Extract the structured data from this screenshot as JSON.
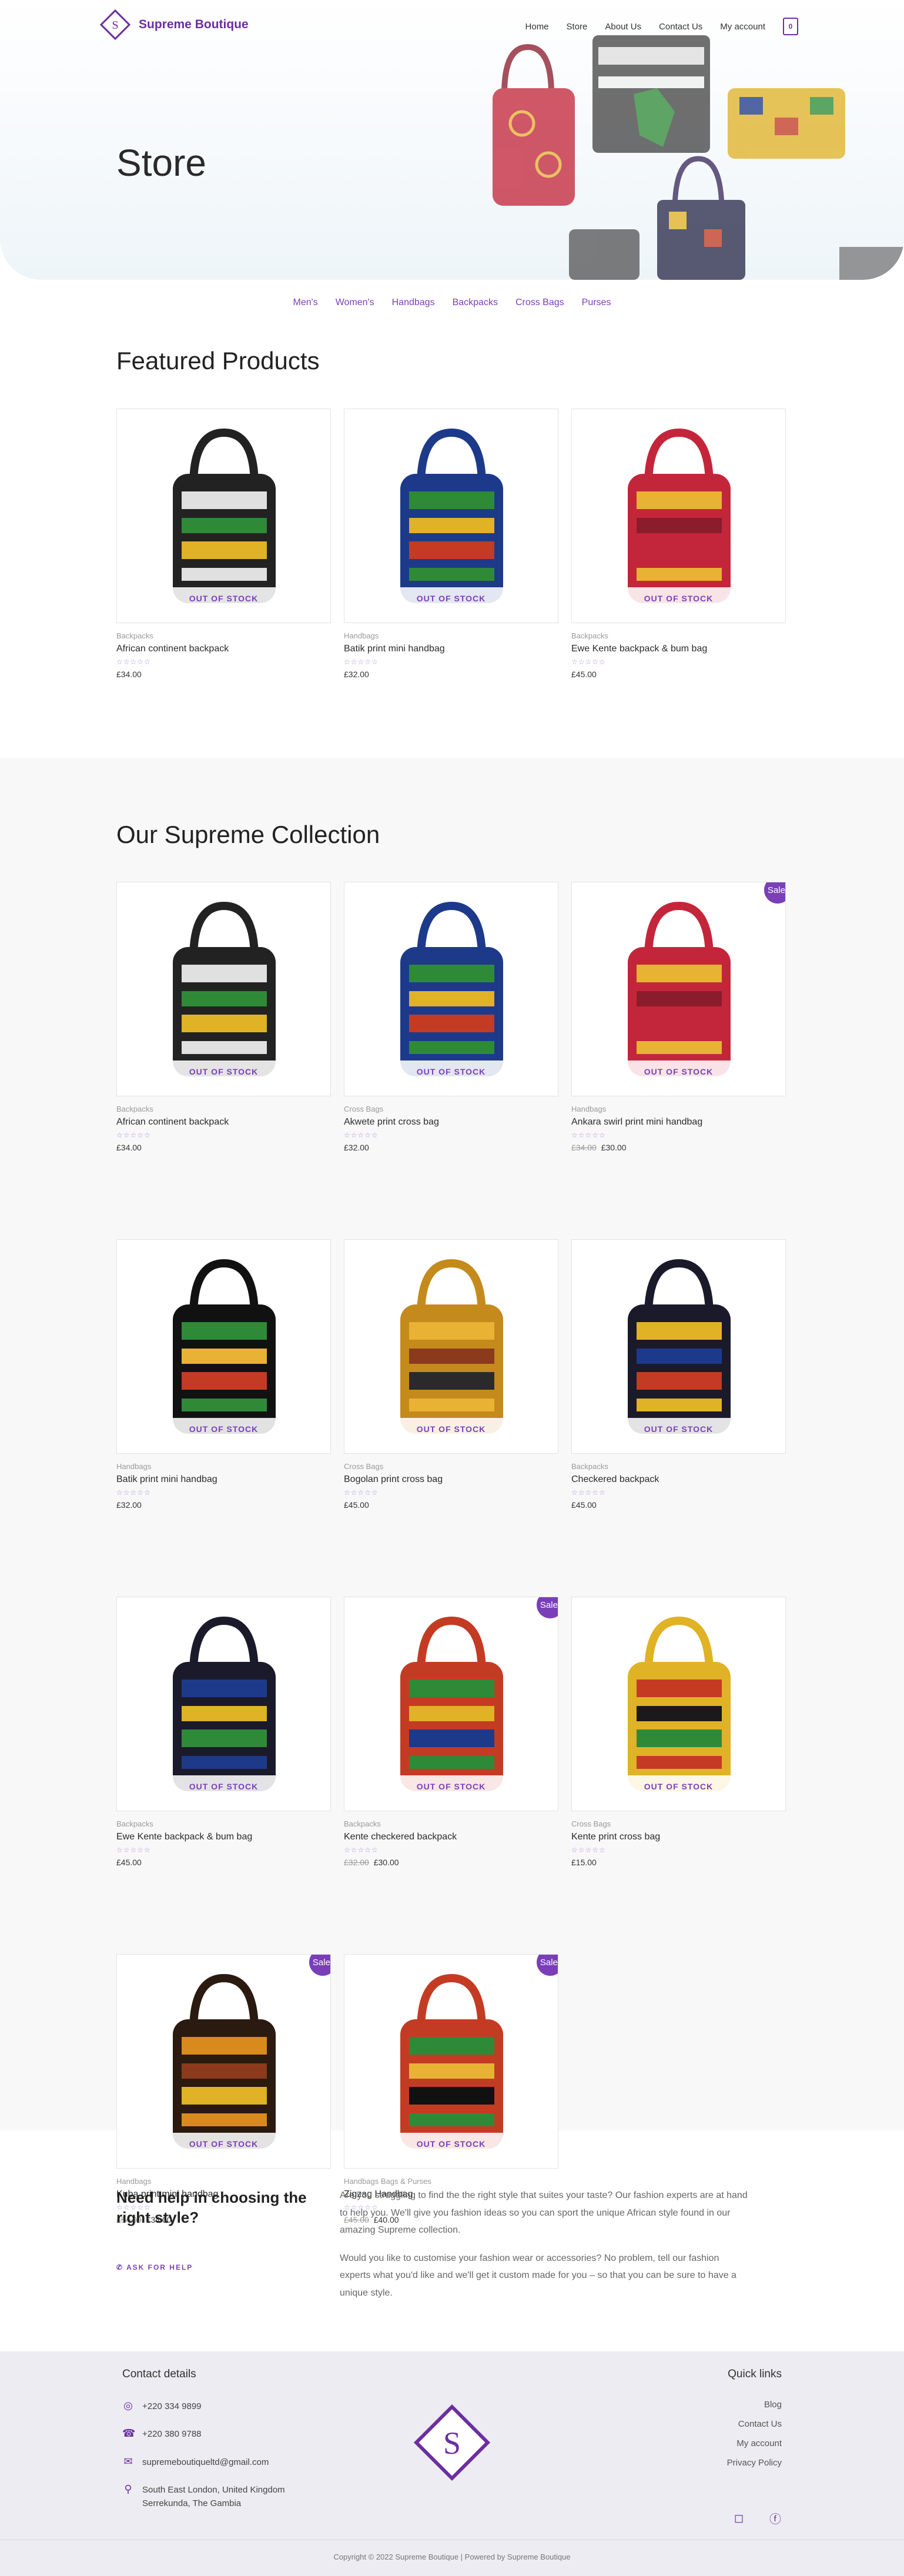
{
  "brand": {
    "name": "Supreme Boutique",
    "logo_letter": "S",
    "color": "#6b2ea0"
  },
  "nav": {
    "items": [
      "Home",
      "Store",
      "About Us",
      "Contact Us",
      "My account"
    ],
    "cart_count": "0"
  },
  "hero": {
    "title": "Store"
  },
  "categories": [
    "Men's",
    "Women's",
    "Handbags",
    "Backpacks",
    "Cross Bags",
    "Purses"
  ],
  "featured": {
    "title": "Featured Products",
    "products": [
      {
        "category": "Backpacks",
        "name": "African continent backpack",
        "price": "£34.00",
        "old_price": "",
        "stock": "OUT OF STOCK",
        "sale": ""
      },
      {
        "category": "Handbags",
        "name": "Batik print mini handbag",
        "price": "£32.00",
        "old_price": "",
        "stock": "OUT OF STOCK",
        "sale": ""
      },
      {
        "category": "Backpacks",
        "name": "Ewe Kente backpack & bum bag",
        "price": "£45.00",
        "old_price": "",
        "stock": "OUT OF STOCK",
        "sale": ""
      }
    ]
  },
  "collection": {
    "title": "Our Supreme Collection",
    "products": [
      {
        "category": "Backpacks",
        "name": "African continent backpack",
        "price": "£34.00",
        "old_price": "",
        "stock": "OUT OF STOCK",
        "sale": ""
      },
      {
        "category": "Cross Bags",
        "name": "Akwete print cross bag",
        "price": "£32.00",
        "old_price": "",
        "stock": "OUT OF STOCK",
        "sale": ""
      },
      {
        "category": "Handbags",
        "name": "Ankara swirl print mini handbag",
        "price": "£30.00",
        "old_price": "£34.00",
        "stock": "OUT OF STOCK",
        "sale": "Sale!"
      },
      {
        "category": "Handbags",
        "name": "Batik print mini handbag",
        "price": "£32.00",
        "old_price": "",
        "stock": "OUT OF STOCK",
        "sale": ""
      },
      {
        "category": "Cross Bags",
        "name": "Bogolan print cross bag",
        "price": "£45.00",
        "old_price": "",
        "stock": "OUT OF STOCK",
        "sale": ""
      },
      {
        "category": "Backpacks",
        "name": "Checkered backpack",
        "price": "£45.00",
        "old_price": "",
        "stock": "OUT OF STOCK",
        "sale": ""
      },
      {
        "category": "Backpacks",
        "name": "Ewe Kente backpack & bum bag",
        "price": "£45.00",
        "old_price": "",
        "stock": "OUT OF STOCK",
        "sale": ""
      },
      {
        "category": "Backpacks",
        "name": "Kente checkered backpack",
        "price": "£30.00",
        "old_price": "£32.00",
        "stock": "OUT OF STOCK",
        "sale": "Sale!"
      },
      {
        "category": "Cross Bags",
        "name": "Kente print cross bag",
        "price": "£15.00",
        "old_price": "",
        "stock": "OUT OF STOCK",
        "sale": ""
      },
      {
        "category": "Handbags",
        "name": "Kuba print mini handbag",
        "price": "£34.00",
        "old_price": "£54.00",
        "stock": "OUT OF STOCK",
        "sale": "Sale!"
      },
      {
        "category": "Handbags Bags & Purses",
        "name": "Zigzag Handbag",
        "price": "£40.00",
        "old_price": "£45.00",
        "stock": "OUT OF STOCK",
        "sale": "Sale!"
      }
    ]
  },
  "rating_stars": "☆☆☆☆☆",
  "help": {
    "title": "Need help in choosing the right style?",
    "button": "ASK FOR HELP",
    "para1": "Are you struggling to find the the right style that suites your taste? Our fashion experts are at hand to help you. We'll give you fashion ideas so you can sport the unique African style found in our amazing Supreme collection.",
    "para2": "Would you like to customise your fashion wear or accessories? No problem, tell our fashion experts what you'd like and we'll get it custom made for you – so that you can be sure to have a unique style."
  },
  "footer": {
    "contact_title": "Contact details",
    "whatsapp": "+220 334 9899",
    "phone": "+220 380 9788",
    "email": "supremeboutiqueltd@gmail.com",
    "address": "South East London, United Kingdom Serrekunda, The Gambia",
    "quick_title": "Quick links",
    "quick_links": [
      "Blog",
      "Contact Us",
      "My account",
      "Privacy Policy"
    ],
    "copyright": "Copyright © 2022 Supreme Boutique | Powered by Supreme Boutique"
  }
}
